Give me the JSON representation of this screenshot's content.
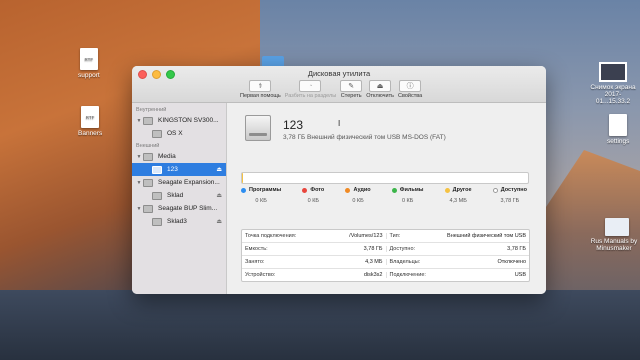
{
  "desktop": {
    "icons": [
      {
        "name": "support",
        "badge": "RTF"
      },
      {
        "name": "Banners",
        "badge": "RTF"
      },
      {
        "name": "settings",
        "badge": ""
      },
      {
        "name": "Rus Manuals by Minusmaker",
        "badge": ""
      },
      {
        "name": "Снимок экрана 2017-01...15.33.2",
        "badge": ""
      }
    ]
  },
  "window": {
    "title": "Дисковая утилита",
    "toolbar": [
      {
        "label": "Первая помощь",
        "icon": "stethoscope-icon",
        "glyph": "⚕",
        "enabled": true
      },
      {
        "label": "Разбить на разделы",
        "icon": "partition-icon",
        "glyph": "◔",
        "enabled": false
      },
      {
        "label": "Стереть",
        "icon": "erase-icon",
        "glyph": "✎",
        "enabled": true
      },
      {
        "label": "Отключить",
        "icon": "unmount-icon",
        "glyph": "⏏",
        "enabled": true
      },
      {
        "label": "Свойства",
        "icon": "info-icon",
        "glyph": "ⓘ",
        "enabled": true
      }
    ]
  },
  "sidebar": {
    "internal_header": "Внутренний",
    "external_header": "Внешний",
    "internal": [
      {
        "label": "KINGSTON SV300...",
        "level": 0
      },
      {
        "label": "OS X",
        "level": 1
      }
    ],
    "external": [
      {
        "label": "Media",
        "level": 0,
        "eject": false,
        "selected": false
      },
      {
        "label": "123",
        "level": 1,
        "eject": true,
        "selected": true
      },
      {
        "label": "Seagate Expansion...",
        "level": 0,
        "eject": false,
        "selected": false
      },
      {
        "label": "Sklad",
        "level": 1,
        "eject": true,
        "selected": false
      },
      {
        "label": "Seagate BUP Slim...",
        "level": 0,
        "eject": false,
        "selected": false
      },
      {
        "label": "Sklad3",
        "level": 1,
        "eject": true,
        "selected": false
      }
    ],
    "eject_glyph": "⏏"
  },
  "volume": {
    "name": "123",
    "description": "3,78 ГБ Внешний физический том USB MS-DOS (FAT)"
  },
  "usage": {
    "used_fraction": 0.0011,
    "used_color": "#f5c242",
    "categories": [
      {
        "label": "Программы",
        "value": "0 КБ",
        "color": "#2d8ef0",
        "ring": false
      },
      {
        "label": "Фото",
        "value": "0 КБ",
        "color": "#e8453c",
        "ring": false
      },
      {
        "label": "Аудио",
        "value": "0 КБ",
        "color": "#f08a24",
        "ring": false
      },
      {
        "label": "Фильмы",
        "value": "0 КБ",
        "color": "#3cb54a",
        "ring": false
      },
      {
        "label": "Другое",
        "value": "4,3 МБ",
        "color": "#f5c242",
        "ring": false
      },
      {
        "label": "Доступно",
        "value": "3,78 ГБ",
        "color": "#ffffff",
        "ring": true
      }
    ]
  },
  "info": [
    {
      "left_label": "Точка подключения:",
      "left_value": "/Volumes/123",
      "right_label": "Тип:",
      "right_value": "Внешний физический том USB"
    },
    {
      "left_label": "Емкость:",
      "left_value": "3,78 ГБ",
      "right_label": "Доступно:",
      "right_value": "3,78 ГБ"
    },
    {
      "left_label": "Занято:",
      "left_value": "4,3 МБ",
      "right_label": "Владельцы:",
      "right_value": "Отключено"
    },
    {
      "left_label": "Устройство:",
      "left_value": "disk3s2",
      "right_label": "Подключение:",
      "right_value": "USB"
    }
  ]
}
